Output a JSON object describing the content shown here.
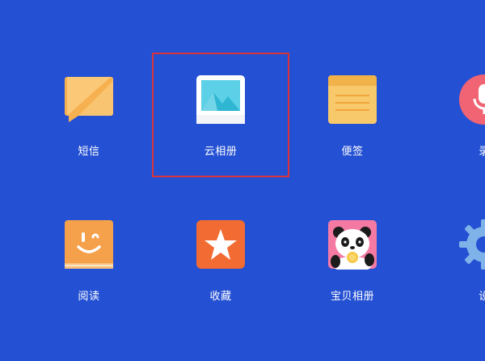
{
  "apps": [
    {
      "key": "sms",
      "label": "短信",
      "icon": "message-icon"
    },
    {
      "key": "cloud_album",
      "label": "云相册",
      "icon": "photo-icon"
    },
    {
      "key": "notes",
      "label": "便签",
      "icon": "notepad-icon"
    },
    {
      "key": "recorder",
      "label": "录",
      "icon": "microphone-icon"
    },
    {
      "key": "reading",
      "label": "阅读",
      "icon": "book-smile-icon"
    },
    {
      "key": "favorites",
      "label": "收藏",
      "icon": "star-icon"
    },
    {
      "key": "baby_album",
      "label": "宝贝相册",
      "icon": "panda-icon"
    },
    {
      "key": "settings",
      "label": "设",
      "icon": "gear-icon"
    }
  ],
  "colors": {
    "background": "#2450d3",
    "selection": "#d8343b"
  },
  "selected_app": "cloud_album"
}
